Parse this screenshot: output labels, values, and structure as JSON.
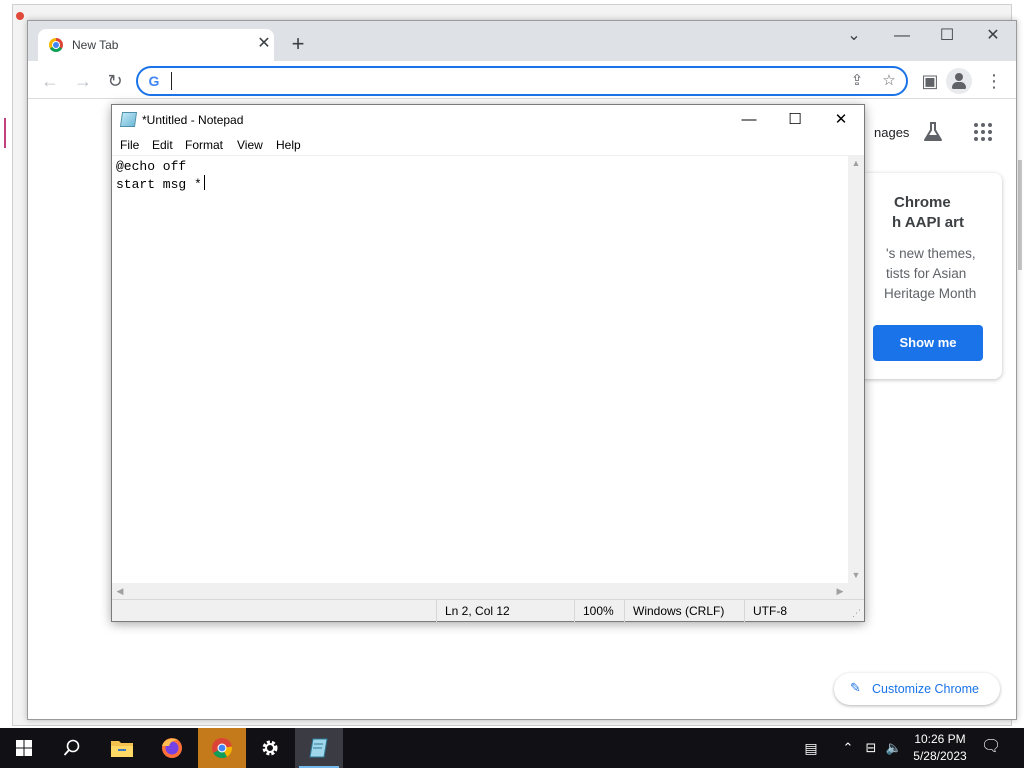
{
  "chrome": {
    "tab_title": "New Tab",
    "tab_close": "✕",
    "new_tab": "+",
    "window_controls": {
      "tab_search": "⌄",
      "minimize": "—",
      "maximize": "☐",
      "close": "✕"
    },
    "toolbar": {
      "back": "←",
      "forward": "→",
      "reload": "↻"
    },
    "omnibox": {
      "value": "",
      "google_g": "G"
    },
    "omnibox_icons": {
      "share": "⇪",
      "bookmark": "☆"
    },
    "side_panel": "▣",
    "menu": "⋮"
  },
  "ntp": {
    "images_link": "nages",
    "promo": {
      "title_line1": "Chrome",
      "title_line2": "h AAPI art",
      "body_line1": "'s new themes,",
      "body_line2": "tists for Asian",
      "body_line3": "Heritage Month",
      "button": "Show me"
    },
    "customize": "Customize Chrome"
  },
  "notepad": {
    "title": "*Untitled - Notepad",
    "controls": {
      "minimize": "—",
      "maximize": "☐",
      "close": "✕"
    },
    "menu": [
      "File",
      "Edit",
      "Format",
      "View",
      "Help"
    ],
    "content": "@echo off\nstart msg *",
    "status": {
      "position": "Ln 2, Col 12",
      "zoom": "100%",
      "line_ending": "Windows (CRLF)",
      "encoding": "UTF-8"
    }
  },
  "taskbar": {
    "apps": [
      "start",
      "search",
      "file-explorer",
      "firefox",
      "chrome",
      "settings",
      "notepad"
    ],
    "time": "10:26 PM",
    "date": "5/28/2023"
  },
  "colors": {
    "accent_blue": "#1a73e8",
    "taskbar": "#101015",
    "chrome_frame": "#dee1e6"
  }
}
